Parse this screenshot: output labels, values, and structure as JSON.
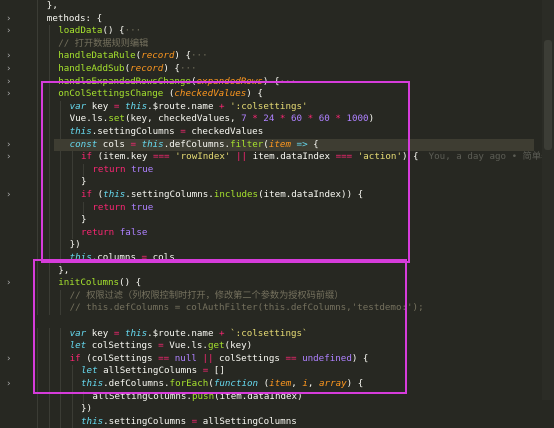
{
  "editor": {
    "lines": [
      {
        "indent": 2,
        "tokens": [
          [
            "pl",
            "},"
          ]
        ]
      },
      {
        "indent": 2,
        "tokens": [
          [
            "pl",
            "methods: {"
          ]
        ]
      },
      {
        "indent": 3,
        "tokens": [
          [
            "fn",
            "loadData"
          ],
          [
            "pl",
            "() {"
          ],
          [
            "cmt",
            "···"
          ]
        ]
      },
      {
        "indent": 3,
        "tokens": [
          [
            "cmt",
            "// 打开数据规则编辑"
          ]
        ]
      },
      {
        "indent": 3,
        "tokens": [
          [
            "fn",
            "handleDataRule"
          ],
          [
            "pl",
            "("
          ],
          [
            "par",
            "record"
          ],
          [
            "pl",
            ") {"
          ],
          [
            "cmt",
            "···"
          ]
        ]
      },
      {
        "indent": 3,
        "tokens": [
          [
            "fn",
            "handleAddSub"
          ],
          [
            "pl",
            "("
          ],
          [
            "par",
            "record"
          ],
          [
            "pl",
            ") {"
          ],
          [
            "cmt",
            "···"
          ]
        ]
      },
      {
        "indent": 3,
        "tokens": [
          [
            "fn",
            "handleExpandedRowsChange"
          ],
          [
            "pl",
            "("
          ],
          [
            "par",
            "expandedRows"
          ],
          [
            "pl",
            ") {"
          ],
          [
            "cmt",
            "···"
          ]
        ]
      },
      {
        "indent": 3,
        "tokens": [
          [
            "fn",
            "onColSettingsChange"
          ],
          [
            "pl",
            " ("
          ],
          [
            "par",
            "checkedValues"
          ],
          [
            "pl",
            ") {"
          ]
        ]
      },
      {
        "indent": 4,
        "tokens": [
          [
            "kw2",
            "var"
          ],
          [
            "pl",
            " key "
          ],
          [
            "kw",
            "="
          ],
          [
            "pl",
            " "
          ],
          [
            "kw2",
            "this"
          ],
          [
            "pl",
            ".$route.name "
          ],
          [
            "kw",
            "+"
          ],
          [
            "pl",
            " "
          ],
          [
            "str",
            "':colsettings'"
          ]
        ]
      },
      {
        "indent": 4,
        "tokens": [
          [
            "pl",
            "Vue.ls."
          ],
          [
            "fn",
            "set"
          ],
          [
            "pl",
            "(key, checkedValues, "
          ],
          [
            "num",
            "7"
          ],
          [
            "pl",
            " "
          ],
          [
            "kw",
            "*"
          ],
          [
            "pl",
            " "
          ],
          [
            "num",
            "24"
          ],
          [
            "pl",
            " "
          ],
          [
            "kw",
            "*"
          ],
          [
            "pl",
            " "
          ],
          [
            "num",
            "60"
          ],
          [
            "pl",
            " "
          ],
          [
            "kw",
            "*"
          ],
          [
            "pl",
            " "
          ],
          [
            "num",
            "60"
          ],
          [
            "pl",
            " "
          ],
          [
            "kw",
            "*"
          ],
          [
            "pl",
            " "
          ],
          [
            "num",
            "1000"
          ],
          [
            "pl",
            ")"
          ]
        ]
      },
      {
        "indent": 4,
        "tokens": [
          [
            "kw2",
            "this"
          ],
          [
            "pl",
            ".settingColumns "
          ],
          [
            "kw",
            "="
          ],
          [
            "pl",
            " checkedValues"
          ]
        ]
      },
      {
        "indent": 4,
        "tokens": [
          [
            "kw2",
            "const"
          ],
          [
            "pl",
            " cols "
          ],
          [
            "kw",
            "="
          ],
          [
            "pl",
            " "
          ],
          [
            "kw2",
            "this"
          ],
          [
            "pl",
            ".defColumns."
          ],
          [
            "fn",
            "filter"
          ],
          [
            "pl",
            "("
          ],
          [
            "par",
            "item"
          ],
          [
            "pl",
            " "
          ],
          [
            "kw2",
            "=>"
          ],
          [
            "pl",
            " {"
          ]
        ]
      },
      {
        "indent": 5,
        "tokens": [
          [
            "kw",
            "if"
          ],
          [
            "pl",
            " (item.key "
          ],
          [
            "kw",
            "==="
          ],
          [
            "pl",
            " "
          ],
          [
            "str",
            "'rowIndex'"
          ],
          [
            "pl",
            " "
          ],
          [
            "kw",
            "||"
          ],
          [
            "pl",
            " item.dataIndex "
          ],
          [
            "kw",
            "==="
          ],
          [
            "pl",
            " "
          ],
          [
            "str",
            "'action'"
          ],
          [
            "pl",
            ") {"
          ]
        ],
        "blame": "You, a day ago • 简单表单增加"
      },
      {
        "indent": 6,
        "tokens": [
          [
            "kw",
            "return"
          ],
          [
            "pl",
            " "
          ],
          [
            "num",
            "true"
          ]
        ]
      },
      {
        "indent": 5,
        "tokens": [
          [
            "pl",
            "}"
          ]
        ]
      },
      {
        "indent": 5,
        "tokens": [
          [
            "kw",
            "if"
          ],
          [
            "pl",
            " ("
          ],
          [
            "kw2",
            "this"
          ],
          [
            "pl",
            ".settingColumns."
          ],
          [
            "fn",
            "includes"
          ],
          [
            "pl",
            "(item.dataIndex)) {"
          ]
        ]
      },
      {
        "indent": 6,
        "tokens": [
          [
            "kw",
            "return"
          ],
          [
            "pl",
            " "
          ],
          [
            "num",
            "true"
          ]
        ]
      },
      {
        "indent": 5,
        "tokens": [
          [
            "pl",
            "}"
          ]
        ]
      },
      {
        "indent": 5,
        "tokens": [
          [
            "kw",
            "return"
          ],
          [
            "pl",
            " "
          ],
          [
            "num",
            "false"
          ]
        ]
      },
      {
        "indent": 4,
        "tokens": [
          [
            "pl",
            "})"
          ]
        ]
      },
      {
        "indent": 4,
        "tokens": [
          [
            "kw2",
            "this"
          ],
          [
            "pl",
            ".columns "
          ],
          [
            "kw",
            "="
          ],
          [
            "pl",
            " cols"
          ]
        ]
      },
      {
        "indent": 3,
        "tokens": [
          [
            "pl",
            "},"
          ]
        ]
      },
      {
        "indent": 3,
        "tokens": [
          [
            "fn",
            "initColumns"
          ],
          [
            "pl",
            "() {"
          ]
        ]
      },
      {
        "indent": 4,
        "tokens": [
          [
            "cmt",
            "// 权限过滤（列权限控制时打开，修改第二个参数为授权码前缀）"
          ]
        ]
      },
      {
        "indent": 4,
        "tokens": [
          [
            "cmt",
            "// this.defColumns = colAuthFilter(this.defColumns,'testdemo:');"
          ]
        ]
      },
      {
        "indent": 0,
        "tokens": []
      },
      {
        "indent": 4,
        "tokens": [
          [
            "kw2",
            "var"
          ],
          [
            "pl",
            " key "
          ],
          [
            "kw",
            "="
          ],
          [
            "pl",
            " "
          ],
          [
            "kw2",
            "this"
          ],
          [
            "pl",
            ".$route.name "
          ],
          [
            "kw",
            "+"
          ],
          [
            "pl",
            " "
          ],
          [
            "str",
            "`:colsettings`"
          ]
        ]
      },
      {
        "indent": 4,
        "tokens": [
          [
            "kw2",
            "let"
          ],
          [
            "pl",
            " colSettings "
          ],
          [
            "kw",
            "="
          ],
          [
            "pl",
            " Vue.ls."
          ],
          [
            "fn",
            "get"
          ],
          [
            "pl",
            "(key)"
          ]
        ]
      },
      {
        "indent": 4,
        "tokens": [
          [
            "kw",
            "if"
          ],
          [
            "pl",
            " (colSettings "
          ],
          [
            "kw",
            "=="
          ],
          [
            "pl",
            " "
          ],
          [
            "num",
            "null"
          ],
          [
            "pl",
            " "
          ],
          [
            "kw",
            "||"
          ],
          [
            "pl",
            " colSettings "
          ],
          [
            "kw",
            "=="
          ],
          [
            "pl",
            " "
          ],
          [
            "num",
            "undefined"
          ],
          [
            "pl",
            ") {"
          ]
        ]
      },
      {
        "indent": 5,
        "tokens": [
          [
            "kw2",
            "let"
          ],
          [
            "pl",
            " allSettingColumns "
          ],
          [
            "kw",
            "="
          ],
          [
            "pl",
            " []"
          ]
        ]
      },
      {
        "indent": 5,
        "tokens": [
          [
            "kw2",
            "this"
          ],
          [
            "pl",
            ".defColumns."
          ],
          [
            "fn",
            "forEach"
          ],
          [
            "pl",
            "("
          ],
          [
            "kw2",
            "function"
          ],
          [
            "pl",
            " ("
          ],
          [
            "par",
            "item"
          ],
          [
            "pl",
            ", "
          ],
          [
            "par",
            "i"
          ],
          [
            "pl",
            ", "
          ],
          [
            "par",
            "array"
          ],
          [
            "pl",
            ") {"
          ]
        ]
      },
      {
        "indent": 6,
        "tokens": [
          [
            "pl",
            "allSettingColumns."
          ],
          [
            "fn",
            "push"
          ],
          [
            "pl",
            "(item.dataIndex)"
          ]
        ]
      },
      {
        "indent": 5,
        "tokens": [
          [
            "pl",
            "})"
          ]
        ]
      },
      {
        "indent": 5,
        "tokens": [
          [
            "kw2",
            "this"
          ],
          [
            "pl",
            ".settingColumns "
          ],
          [
            "kw",
            "="
          ],
          [
            "pl",
            " allSettingColumns"
          ]
        ]
      }
    ],
    "folded_lines": [
      1,
      2,
      4,
      5,
      6,
      7,
      11,
      12,
      15,
      22,
      28,
      30
    ],
    "colors": {
      "background": "#272822",
      "highlight_box": "#d63cdb",
      "keyword": "#f92672",
      "function": "#a6e22e",
      "string": "#e6db74",
      "number": "#ae81ff",
      "comment": "#75715e",
      "parameter": "#fd971f"
    }
  }
}
